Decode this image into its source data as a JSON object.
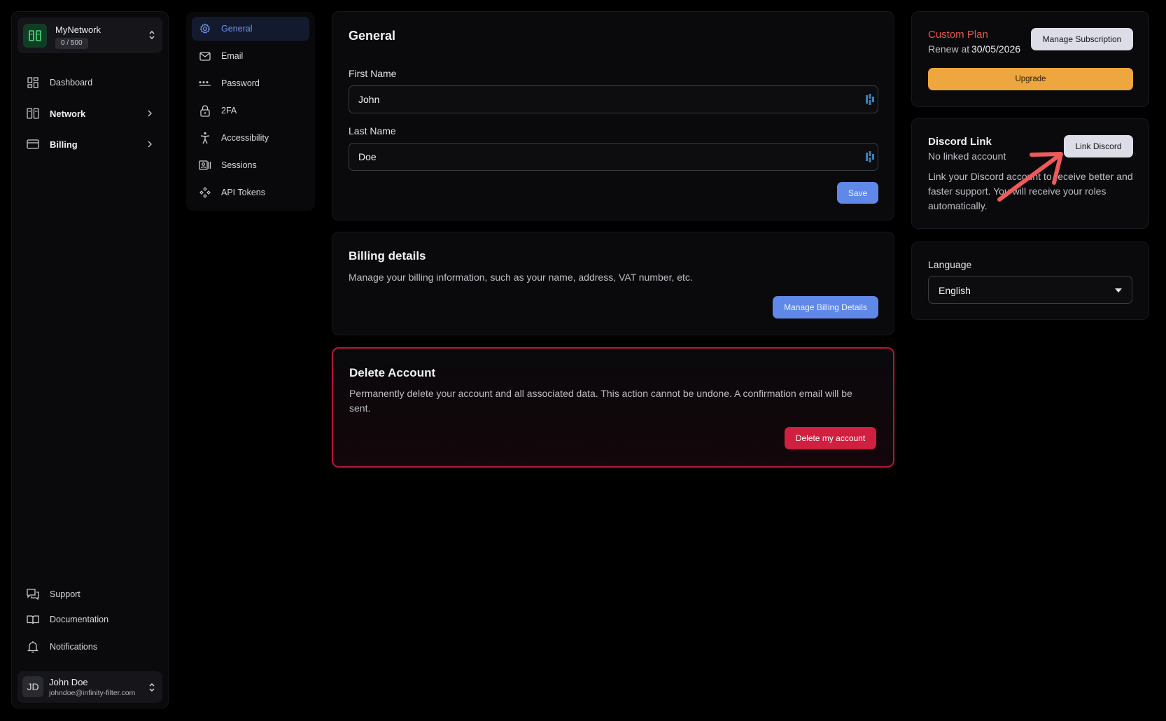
{
  "sidebar": {
    "network": {
      "name": "MyNetwork",
      "quota": "0 / 500"
    },
    "nav": [
      {
        "label": "Dashboard"
      },
      {
        "label": "Network"
      },
      {
        "label": "Billing"
      }
    ],
    "bottom": [
      {
        "label": "Support"
      },
      {
        "label": "Documentation"
      },
      {
        "label": "Notifications"
      }
    ],
    "user": {
      "initials": "JD",
      "name": "John Doe",
      "email": "johndoe@infinity-filter.com"
    }
  },
  "settings_nav": [
    {
      "label": "General",
      "active": true
    },
    {
      "label": "Email"
    },
    {
      "label": "Password"
    },
    {
      "label": "2FA"
    },
    {
      "label": "Accessibility"
    },
    {
      "label": "Sessions"
    },
    {
      "label": "API Tokens"
    }
  ],
  "general": {
    "title": "General",
    "first_name_label": "First Name",
    "first_name_value": "John",
    "last_name_label": "Last Name",
    "last_name_value": "Doe",
    "save_label": "Save"
  },
  "billing_details": {
    "title": "Billing details",
    "description": "Manage your billing information, such as your name, address, VAT number, etc.",
    "button_label": "Manage Billing Details"
  },
  "delete_account": {
    "title": "Delete Account",
    "description": "Permanently delete your account and all associated data. This action cannot be undone. A confirmation email will be sent.",
    "button_label": "Delete my account"
  },
  "plan": {
    "name": "Custom Plan",
    "renew_prefix": "Renew at",
    "renew_date": "30/05/2026",
    "manage_label": "Manage Subscription",
    "upgrade_label": "Upgrade"
  },
  "discord": {
    "title": "Discord Link",
    "status": "No linked account",
    "description": "Link your Discord account to receive better and faster support. You will receive your roles automatically.",
    "button_label": "Link Discord"
  },
  "language": {
    "label": "Language",
    "selected": "English"
  },
  "colors": {
    "accent_blue": "#5f88e8",
    "danger_red": "#d11f3f",
    "plan_red": "#e5574a",
    "upgrade_orange": "#eea63e",
    "annotation_arrow": "#ee5a5a"
  }
}
